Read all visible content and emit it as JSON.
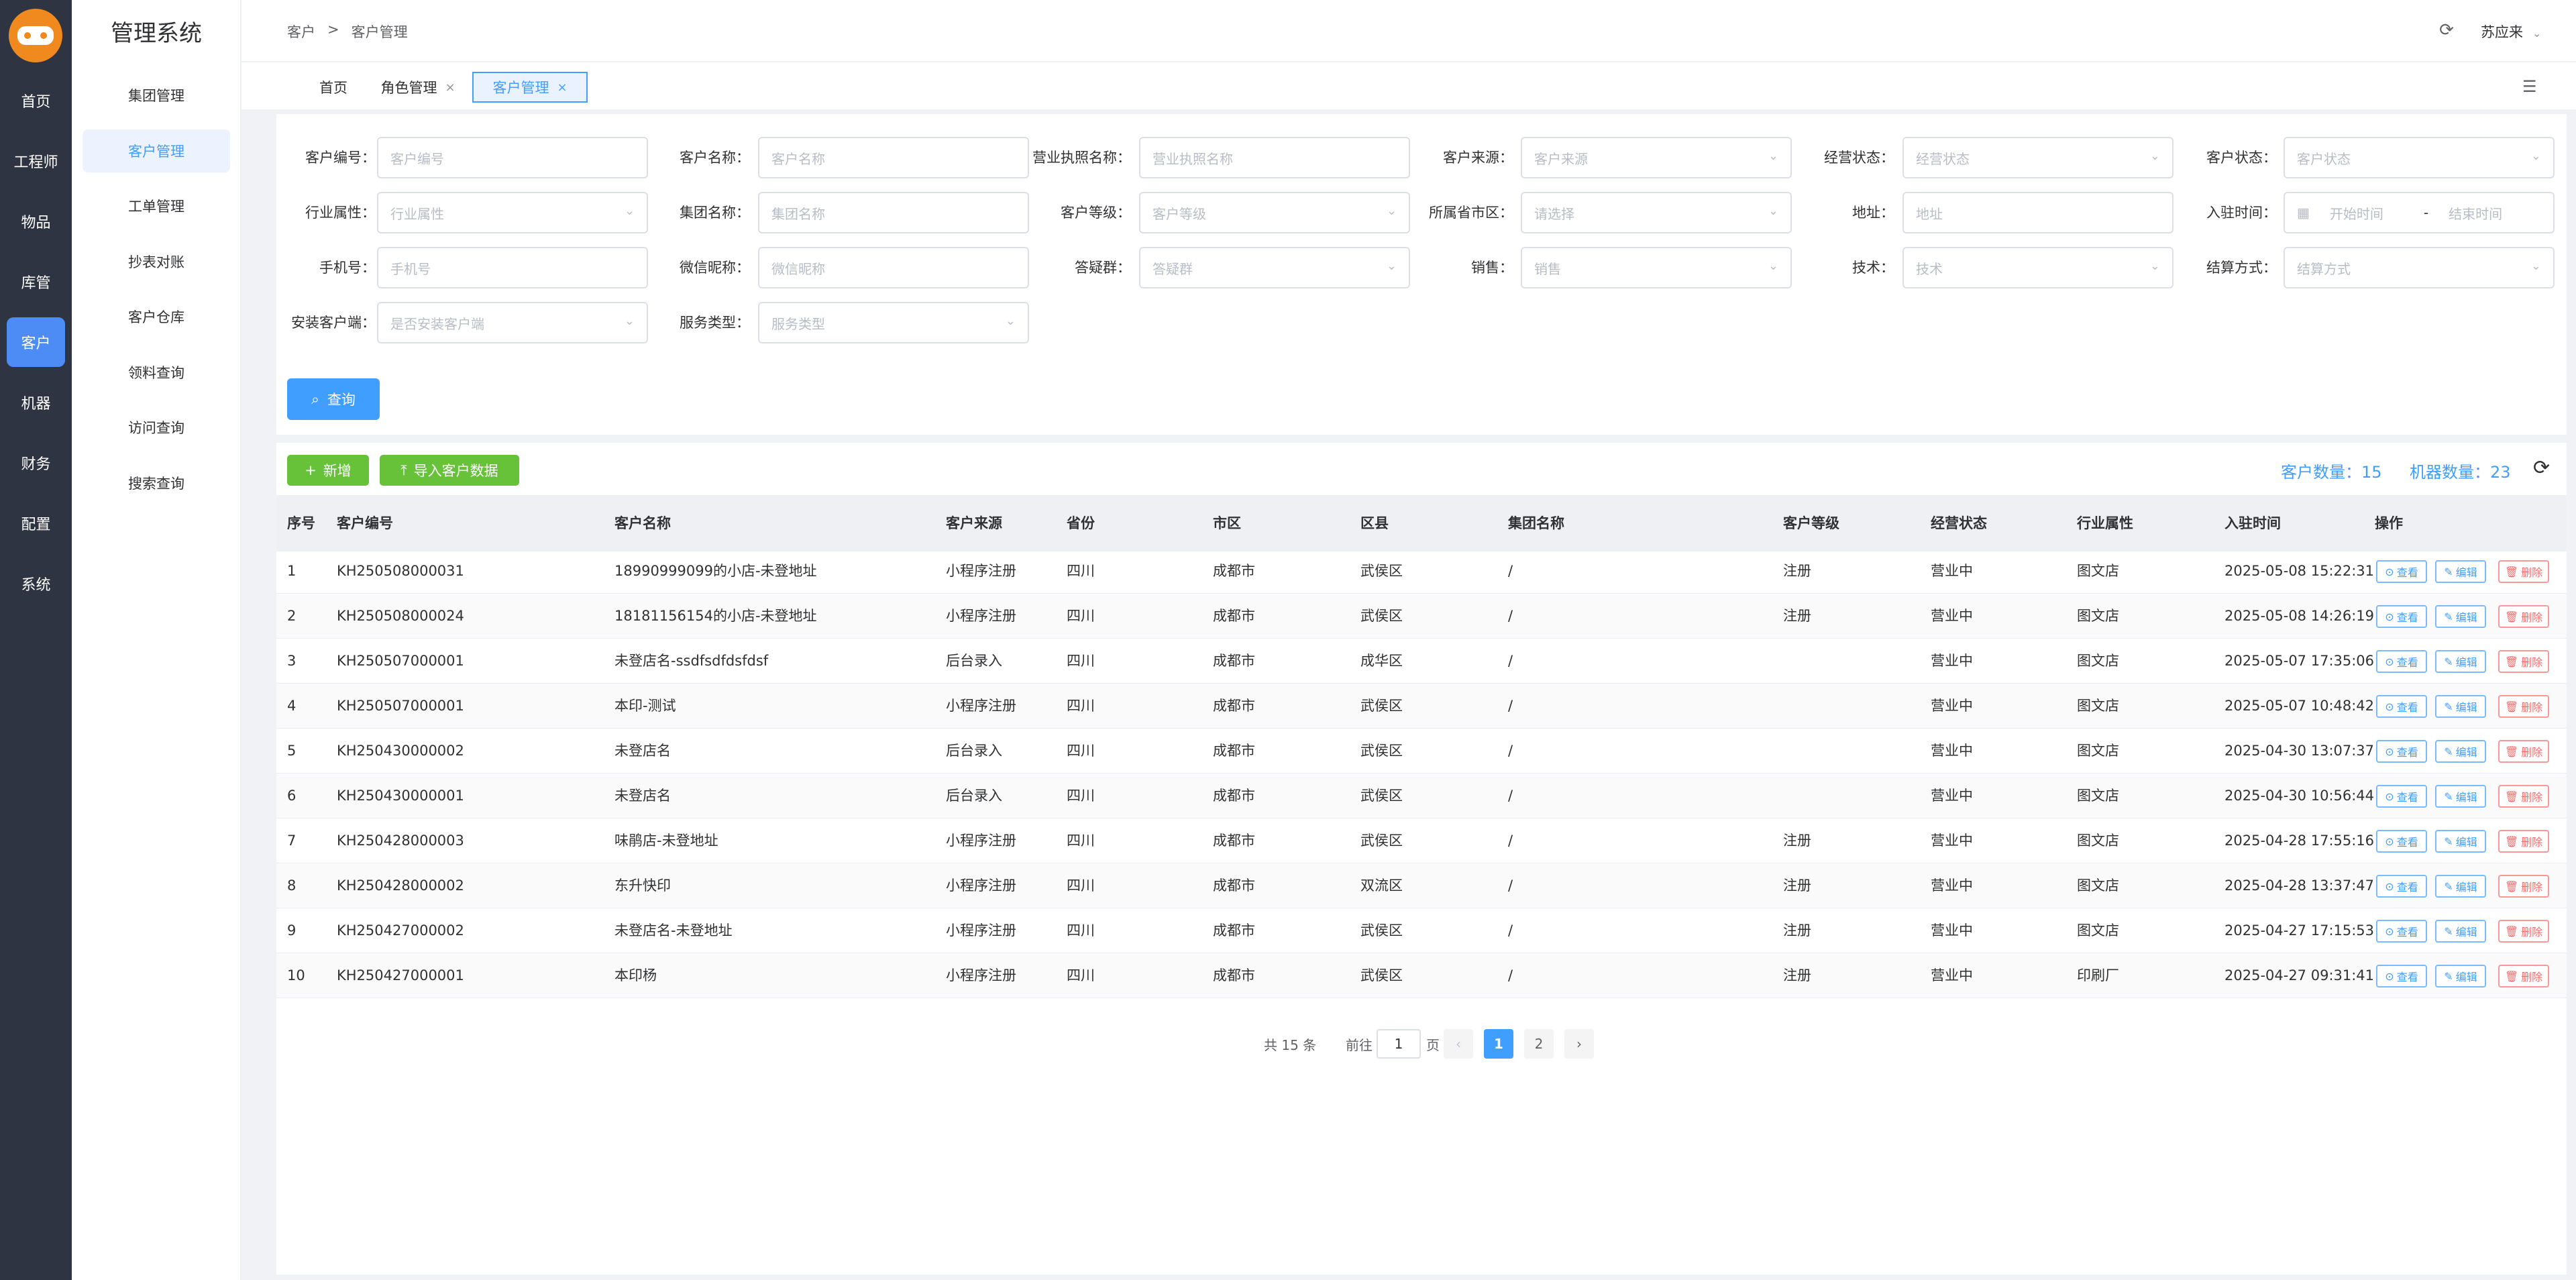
{
  "nav": {
    "items": [
      {
        "label": "首页",
        "active": false
      },
      {
        "label": "工程师",
        "active": false
      },
      {
        "label": "物品",
        "active": false
      },
      {
        "label": "库管",
        "active": false
      },
      {
        "label": "客户",
        "active": true
      },
      {
        "label": "机器",
        "active": false
      },
      {
        "label": "财务",
        "active": false
      },
      {
        "label": "配置",
        "active": false
      },
      {
        "label": "系统",
        "active": false
      }
    ]
  },
  "sidebar": {
    "title": "管理系统",
    "items": [
      {
        "label": "集团管理",
        "active": false
      },
      {
        "label": "客户管理",
        "active": true
      },
      {
        "label": "工单管理",
        "active": false
      },
      {
        "label": "抄表对账",
        "active": false
      },
      {
        "label": "客户仓库",
        "active": false
      },
      {
        "label": "领料查询",
        "active": false
      },
      {
        "label": "访问查询",
        "active": false
      },
      {
        "label": "搜索查询",
        "active": false
      }
    ]
  },
  "header": {
    "breadcrumb": [
      "客户",
      ">",
      "客户管理"
    ],
    "user": "苏应来"
  },
  "tabs": [
    {
      "label": "首页",
      "closable": false,
      "active": false
    },
    {
      "label": "角色管理",
      "closable": true,
      "active": false
    },
    {
      "label": "客户管理",
      "closable": true,
      "active": true
    }
  ],
  "filters": [
    {
      "label": "客户编号：",
      "placeholder": "客户编号",
      "type": "input"
    },
    {
      "label": "客户名称：",
      "placeholder": "客户名称",
      "type": "input"
    },
    {
      "label": "营业执照名称：",
      "placeholder": "营业执照名称",
      "type": "input"
    },
    {
      "label": "客户来源：",
      "placeholder": "客户来源",
      "type": "select"
    },
    {
      "label": "经营状态：",
      "placeholder": "经营状态",
      "type": "select"
    },
    {
      "label": "客户状态：",
      "placeholder": "客户状态",
      "type": "select"
    },
    {
      "label": "行业属性：",
      "placeholder": "行业属性",
      "type": "select"
    },
    {
      "label": "集团名称：",
      "placeholder": "集团名称",
      "type": "input"
    },
    {
      "label": "客户等级：",
      "placeholder": "客户等级",
      "type": "select"
    },
    {
      "label": "所属省市区：",
      "placeholder": "请选择",
      "type": "select"
    },
    {
      "label": "地址：",
      "placeholder": "地址",
      "type": "input"
    },
    {
      "label": "入驻时间：",
      "placeholder": "",
      "type": "daterange",
      "start": "开始时间",
      "sep": "-",
      "end": "结束时间"
    },
    {
      "label": "手机号：",
      "placeholder": "手机号",
      "type": "input"
    },
    {
      "label": "微信昵称：",
      "placeholder": "微信昵称",
      "type": "input"
    },
    {
      "label": "答疑群：",
      "placeholder": "答疑群",
      "type": "select"
    },
    {
      "label": "销售：",
      "placeholder": "销售",
      "type": "select"
    },
    {
      "label": "技术：",
      "placeholder": "技术",
      "type": "select"
    },
    {
      "label": "结算方式：",
      "placeholder": "结算方式",
      "type": "select"
    },
    {
      "label": "安装客户端：",
      "placeholder": "是否安装客户端",
      "type": "select"
    },
    {
      "label": "服务类型：",
      "placeholder": "服务类型",
      "type": "select"
    }
  ],
  "query_label": "查询",
  "toolbar": {
    "add_label": "新增",
    "import_label": "导入客户数据",
    "customer_count": "客户数量：15",
    "machine_count": "机器数量：23"
  },
  "table": {
    "columns": [
      "序号",
      "客户编号",
      "客户名称",
      "客户来源",
      "省份",
      "市区",
      "区县",
      "集团名称",
      "客户等级",
      "经营状态",
      "行业属性",
      "入驻时间",
      "操作"
    ],
    "actions": {
      "view": "查看",
      "edit": "编辑",
      "delete": "删除"
    },
    "rows": [
      [
        "1",
        "KH250508000031",
        "18990999099的小店-未登地址",
        "小程序注册",
        "四川",
        "成都市",
        "武侯区",
        "/",
        "注册",
        "营业中",
        "图文店",
        "2025-05-08 15:22:31"
      ],
      [
        "2",
        "KH250508000024",
        "18181156154的小店-未登地址",
        "小程序注册",
        "四川",
        "成都市",
        "武侯区",
        "/",
        "注册",
        "营业中",
        "图文店",
        "2025-05-08 14:26:19"
      ],
      [
        "3",
        "KH250507000001",
        "未登店名-ssdfsdfdsfdsf",
        "后台录入",
        "四川",
        "成都市",
        "成华区",
        "/",
        "",
        "营业中",
        "图文店",
        "2025-05-07 17:35:06"
      ],
      [
        "4",
        "KH250507000001",
        "本印-测试",
        "小程序注册",
        "四川",
        "成都市",
        "武侯区",
        "/",
        "",
        "营业中",
        "图文店",
        "2025-05-07 10:48:42"
      ],
      [
        "5",
        "KH250430000002",
        "未登店名",
        "后台录入",
        "四川",
        "成都市",
        "武侯区",
        "/",
        "",
        "营业中",
        "图文店",
        "2025-04-30 13:07:37"
      ],
      [
        "6",
        "KH250430000001",
        "未登店名",
        "后台录入",
        "四川",
        "成都市",
        "武侯区",
        "/",
        "",
        "营业中",
        "图文店",
        "2025-04-30 10:56:44"
      ],
      [
        "7",
        "KH250428000003",
        "味鹃店-未登地址",
        "小程序注册",
        "四川",
        "成都市",
        "武侯区",
        "/",
        "注册",
        "营业中",
        "图文店",
        "2025-04-28 17:55:16"
      ],
      [
        "8",
        "KH250428000002",
        "东升快印",
        "小程序注册",
        "四川",
        "成都市",
        "双流区",
        "/",
        "注册",
        "营业中",
        "图文店",
        "2025-04-28 13:37:47"
      ],
      [
        "9",
        "KH250427000002",
        "未登店名-未登地址",
        "小程序注册",
        "四川",
        "成都市",
        "武侯区",
        "/",
        "注册",
        "营业中",
        "图文店",
        "2025-04-27 17:15:53"
      ],
      [
        "10",
        "KH250427000001",
        "本印杨",
        "小程序注册",
        "四川",
        "成都市",
        "武侯区",
        "/",
        "注册",
        "营业中",
        "印刷厂",
        "2025-04-27 09:31:41"
      ]
    ]
  },
  "pagination": {
    "total": "共 15 条",
    "goto_prefix": "前往",
    "goto_value": "1",
    "goto_suffix": "页",
    "prev": "‹",
    "pages": [
      "1",
      "2"
    ],
    "current": "1",
    "next": "›"
  },
  "colors": {
    "primary": "#409eff",
    "success": "#67c23a",
    "danger": "#f56c6c",
    "nav_bg": "#2f3443"
  }
}
